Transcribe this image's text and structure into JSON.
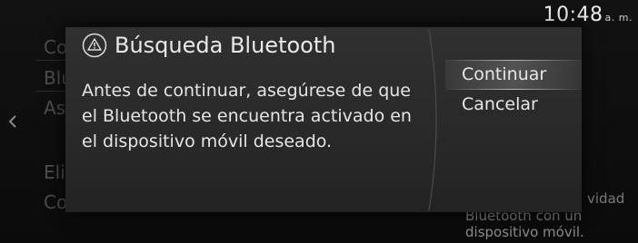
{
  "status": {
    "time": "10:48",
    "ampm": "a. m."
  },
  "background": {
    "items": [
      {
        "label": "Co"
      },
      {
        "label": "Blu"
      },
      {
        "label": "As"
      },
      {
        "label": "Eli"
      },
      {
        "label": "Co"
      }
    ],
    "side_text_1": "vidad",
    "side_text_2": "Bluetooth con un",
    "side_text_3": "dispositivo móvil."
  },
  "dialog": {
    "icon": "warning-triangle-icon",
    "title": "Búsqueda Bluetooth",
    "message": "Antes de continuar, asegúrese de que el Bluetooth se encuentra activado en el dispositivo móvil deseado.",
    "options": [
      {
        "label": "Continuar",
        "selected": true
      },
      {
        "label": "Cancelar",
        "selected": false
      }
    ]
  },
  "colors": {
    "dialog_bg": "#2a2a2a",
    "text": "#e6e6e6",
    "dimmed_text": "#4d4d4d"
  }
}
